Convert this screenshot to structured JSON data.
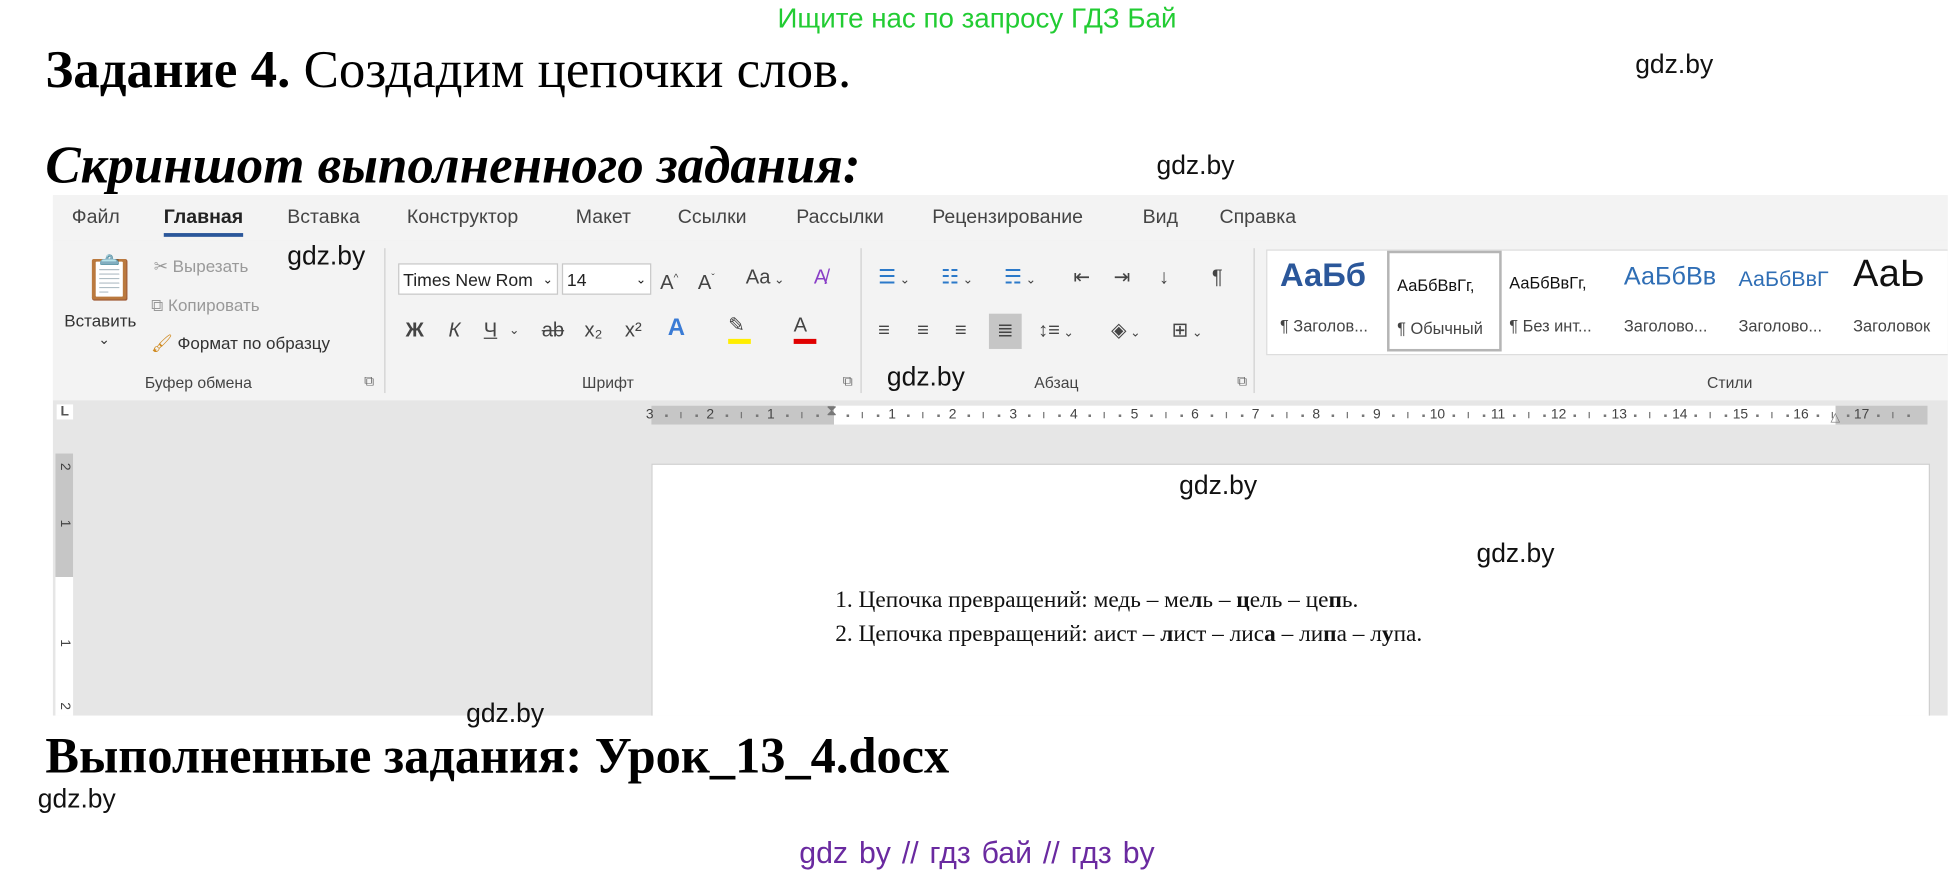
{
  "banner": "Ищите нас по запросу ГДЗ Бай",
  "task": {
    "title_bold": "Задание 4.",
    "title_rest": " Создадим цепочки слов.",
    "subtitle": "Скриншот выполненного задания:",
    "result": "Выполненные задания: Урок_13_4.docx"
  },
  "watermark": "gdz.by",
  "footer": "gdz by  //  гдз бай  //  гдз by",
  "word": {
    "tabs": [
      {
        "label": "Файл"
      },
      {
        "label": "Главная",
        "active": true
      },
      {
        "label": "Вставка"
      },
      {
        "label": "Конструктор"
      },
      {
        "label": "Макет"
      },
      {
        "label": "Ссылки"
      },
      {
        "label": "Рассылки"
      },
      {
        "label": "Рецензирование"
      },
      {
        "label": "Вид"
      },
      {
        "label": "Справка"
      }
    ],
    "clipboard": {
      "paste": "Вставить",
      "cut": "Вырезать",
      "copy": "Копировать",
      "format_painter": "Формат по образцу",
      "group": "Буфер обмена"
    },
    "font": {
      "name": "Times New Rom",
      "size": "14",
      "group": "Шрифт",
      "bold": "Ж",
      "italic": "К",
      "underline": "Ч",
      "strike": "ab",
      "sub": "x₂",
      "sup": "x²",
      "case": "Aa"
    },
    "paragraph": {
      "group": "Абзац"
    },
    "styles": {
      "group": "Стили",
      "items": [
        {
          "preview": "АаБб",
          "name": "¶ Заголов..."
        },
        {
          "preview": "АаБбВвГг,",
          "name": "¶ Обычный",
          "selected": true
        },
        {
          "preview": "АаБбВвГг,",
          "name": "¶ Без инт..."
        },
        {
          "preview": "АаБбВв",
          "name": "Заголово..."
        },
        {
          "preview": "АаБбВвГ",
          "name": "Заголово..."
        },
        {
          "preview": "АаЬ",
          "name": "Заголовок"
        }
      ]
    },
    "ruler": {
      "left_margin": [
        "3",
        "2",
        "1"
      ],
      "numbers": [
        "1",
        "2",
        "3",
        "4",
        "5",
        "6",
        "7",
        "8",
        "9",
        "10",
        "11",
        "12",
        "13",
        "14",
        "15",
        "16",
        "17"
      ]
    },
    "vruler": [
      "2",
      "1",
      "1",
      "2"
    ],
    "document": {
      "lines": [
        {
          "number": "1.",
          "parts": [
            {
              "t": " Цепочка превращений: медь – ме"
            },
            {
              "t": "л",
              "b": true
            },
            {
              "t": "ь – "
            },
            {
              "t": "ц",
              "b": true
            },
            {
              "t": "ель – це"
            },
            {
              "t": "п",
              "b": true
            },
            {
              "t": "ь."
            }
          ]
        },
        {
          "number": "2.",
          "parts": [
            {
              "t": " Цепочка превращений: аист – "
            },
            {
              "t": "л",
              "b": true
            },
            {
              "t": "ист – лис"
            },
            {
              "t": "а",
              "b": true
            },
            {
              "t": " – ли"
            },
            {
              "t": "п",
              "b": true
            },
            {
              "t": "а – л"
            },
            {
              "t": "у",
              "b": true
            },
            {
              "t": "па."
            }
          ]
        }
      ]
    }
  },
  "colors": {
    "accent": "#2b579a",
    "banner": "#22cc33",
    "footer": "#6a2aa0",
    "highlight": "#ffee00",
    "font_color": "#e00000"
  }
}
